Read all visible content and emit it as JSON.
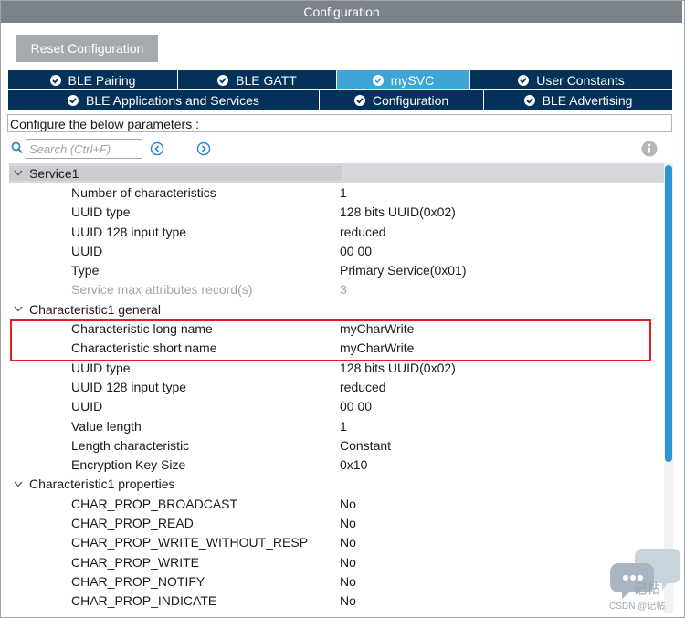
{
  "window": {
    "title": "Configuration"
  },
  "toolbar": {
    "reset_label": "Reset Configuration"
  },
  "tabs_row1": [
    {
      "label": "BLE Pairing",
      "active": false
    },
    {
      "label": "BLE GATT",
      "active": false
    },
    {
      "label": "mySVC",
      "active": true
    },
    {
      "label": "User Constants",
      "active": false
    }
  ],
  "tabs_row2": [
    {
      "label": "BLE Applications and Services",
      "active": false
    },
    {
      "label": "Configuration",
      "active": false
    },
    {
      "label": "BLE Advertising",
      "active": false
    }
  ],
  "params_label": "Configure the below parameters :",
  "search": {
    "placeholder": "Search (Ctrl+F)"
  },
  "tree": [
    {
      "kind": "group",
      "label": "Service1"
    },
    {
      "kind": "param",
      "name": "Number of characteristics",
      "value": "1"
    },
    {
      "kind": "param",
      "name": "UUID type",
      "value": "128 bits UUID(0x02)"
    },
    {
      "kind": "param",
      "name": "UUID 128 input type",
      "value": "reduced"
    },
    {
      "kind": "param",
      "name": "UUID",
      "value": "00 00"
    },
    {
      "kind": "param",
      "name": "Type",
      "value": "Primary Service(0x01)"
    },
    {
      "kind": "param",
      "name": "Service max attributes record(s)",
      "value": "3",
      "disabled": true
    },
    {
      "kind": "group",
      "label": "Characteristic1 general"
    },
    {
      "kind": "param",
      "name": "Characteristic long name",
      "value": "myCharWrite"
    },
    {
      "kind": "param",
      "name": "Characteristic short name",
      "value": "myCharWrite"
    },
    {
      "kind": "param",
      "name": "UUID type",
      "value": "128 bits UUID(0x02)"
    },
    {
      "kind": "param",
      "name": "UUID 128 input type",
      "value": "reduced"
    },
    {
      "kind": "param",
      "name": "UUID",
      "value": "00 00"
    },
    {
      "kind": "param",
      "name": "Value length",
      "value": "1"
    },
    {
      "kind": "param",
      "name": "Length characteristic",
      "value": "Constant"
    },
    {
      "kind": "param",
      "name": "Encryption Key Size",
      "value": "0x10"
    },
    {
      "kind": "group",
      "label": "Characteristic1 properties"
    },
    {
      "kind": "param",
      "name": "CHAR_PROP_BROADCAST",
      "value": "No"
    },
    {
      "kind": "param",
      "name": "CHAR_PROP_READ",
      "value": "No"
    },
    {
      "kind": "param",
      "name": "CHAR_PROP_WRITE_WITHOUT_RESP",
      "value": "No"
    },
    {
      "kind": "param",
      "name": "CHAR_PROP_WRITE",
      "value": "No"
    },
    {
      "kind": "param",
      "name": "CHAR_PROP_NOTIFY",
      "value": "No"
    },
    {
      "kind": "param",
      "name": "CHAR_PROP_INDICATE",
      "value": "No"
    }
  ],
  "watermark": {
    "text": "记帖",
    "sub": "CSDN @记帖"
  },
  "colors": {
    "tab_bg": "#04315a",
    "tab_active": "#3fa5d7",
    "titlebar": "#7b8289",
    "highlight": "#e02020",
    "scrollbar": "#2b95d6"
  },
  "icons": {
    "search": "search-icon",
    "prev": "chevron-left-circle-icon",
    "next": "chevron-right-circle-icon",
    "info": "info-icon",
    "check": "check-circle-icon",
    "expand": "chevron-down-icon"
  }
}
